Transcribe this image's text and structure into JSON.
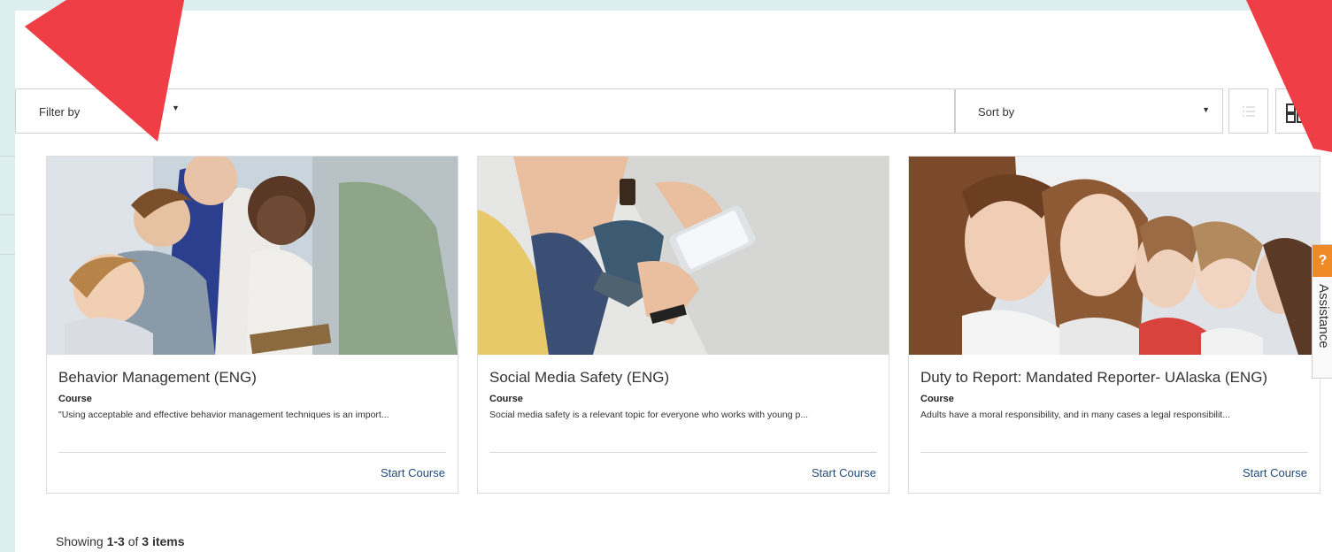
{
  "toolbar": {
    "filter_label": "Filter by",
    "sort_label": "Sort by",
    "list_view_icon": "list-icon",
    "grid_view_icon": "grid-icon"
  },
  "courses": [
    {
      "title": "Behavior Management (ENG)",
      "type": "Course",
      "description": "\"Using acceptable and effective behavior management techniques is an import...",
      "action": "Start Course"
    },
    {
      "title": "Social Media Safety (ENG)",
      "type": "Course",
      "description": "Social media safety is a relevant topic for everyone who works with young p...",
      "action": "Start Course"
    },
    {
      "title": "Duty to Report: Mandated Reporter- UAlaska (ENG)",
      "type": "Course",
      "description": "Adults have a moral responsibility, and in many cases a legal responsibilit...",
      "action": "Start Course"
    }
  ],
  "pagination": {
    "prefix": "Showing ",
    "range": "1-3",
    "middle": " of ",
    "total": "3 items"
  },
  "assistance": {
    "badge": "?",
    "label": "Assistance"
  },
  "colors": {
    "accent_orange": "#ef8a26",
    "link_blue": "#1f4a7a",
    "arrow_red": "#ef3e45",
    "background": "#dcefee"
  }
}
